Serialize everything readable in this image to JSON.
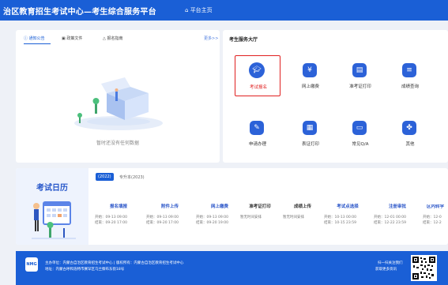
{
  "header": {
    "title": "治区教育招生考试中心—考生综合服务平台",
    "home_label": "平台主页"
  },
  "notice": {
    "tabs": [
      "通知公告",
      "政策文件",
      "报名指南"
    ],
    "more": "更多>>",
    "empty_text": "暂时还没有任何数据"
  },
  "services": {
    "title": "考生服务大厅",
    "items": [
      {
        "label": "考试报名",
        "icon": "graduation-cap-icon",
        "selected": true
      },
      {
        "label": "网上缴费",
        "icon": "payment-icon"
      },
      {
        "label": "准考证打印",
        "icon": "printer-icon"
      },
      {
        "label": "成绩查询",
        "icon": "document-icon"
      },
      {
        "label": "申请办理",
        "icon": "edit-form-icon"
      },
      {
        "label": "表证打印",
        "icon": "print-form-icon"
      },
      {
        "label": "常见Q/A",
        "icon": "chat-icon"
      },
      {
        "label": "其他",
        "icon": "grid-icon"
      }
    ]
  },
  "calendar": {
    "title": "考试日历",
    "year_tabs": [
      "(2022)",
      "专升本(2023)"
    ],
    "columns": [
      {
        "name": "报名填报",
        "start": "开始：09-13 09:00",
        "end": "结束：09-20 17:00"
      },
      {
        "name": "附件上传",
        "start": "开始：09-13 09:00",
        "end": "结束：09-20 17:00"
      },
      {
        "name": "网上缴费",
        "start": "开始：09-13 09:00",
        "end": "结束：09-20 19:00"
      },
      {
        "name": "准考证打印",
        "start": "暂无时间安排",
        "end": ""
      },
      {
        "name": "成绩上传",
        "start": "暂无时间安排",
        "end": ""
      },
      {
        "name": "考试点选择",
        "start": "开始：10-13 00:00",
        "end": "结束：10-15 23:59"
      },
      {
        "name": "注册审批",
        "start": "开始：12-01 00:00",
        "end": "结束：12-22 23:59"
      },
      {
        "name": "区内转学",
        "start": "开始：12-0",
        "end": "结束：12-2"
      }
    ]
  },
  "footer": {
    "logo_text": "NMG",
    "line1": "主办单位：内蒙古自治区教育招生考试中心 | 版权所有：内蒙古自治区教育招生考试中心",
    "line2": "地址：内蒙古呼和浩特市赛罕区乌兰察布东街18号",
    "qr_line1": "扫一扫关注我们",
    "qr_line2": "获取更多资讯"
  },
  "colors": {
    "primary": "#1a5fd6",
    "highlight": "#e02020",
    "background": "#eef1f7"
  }
}
